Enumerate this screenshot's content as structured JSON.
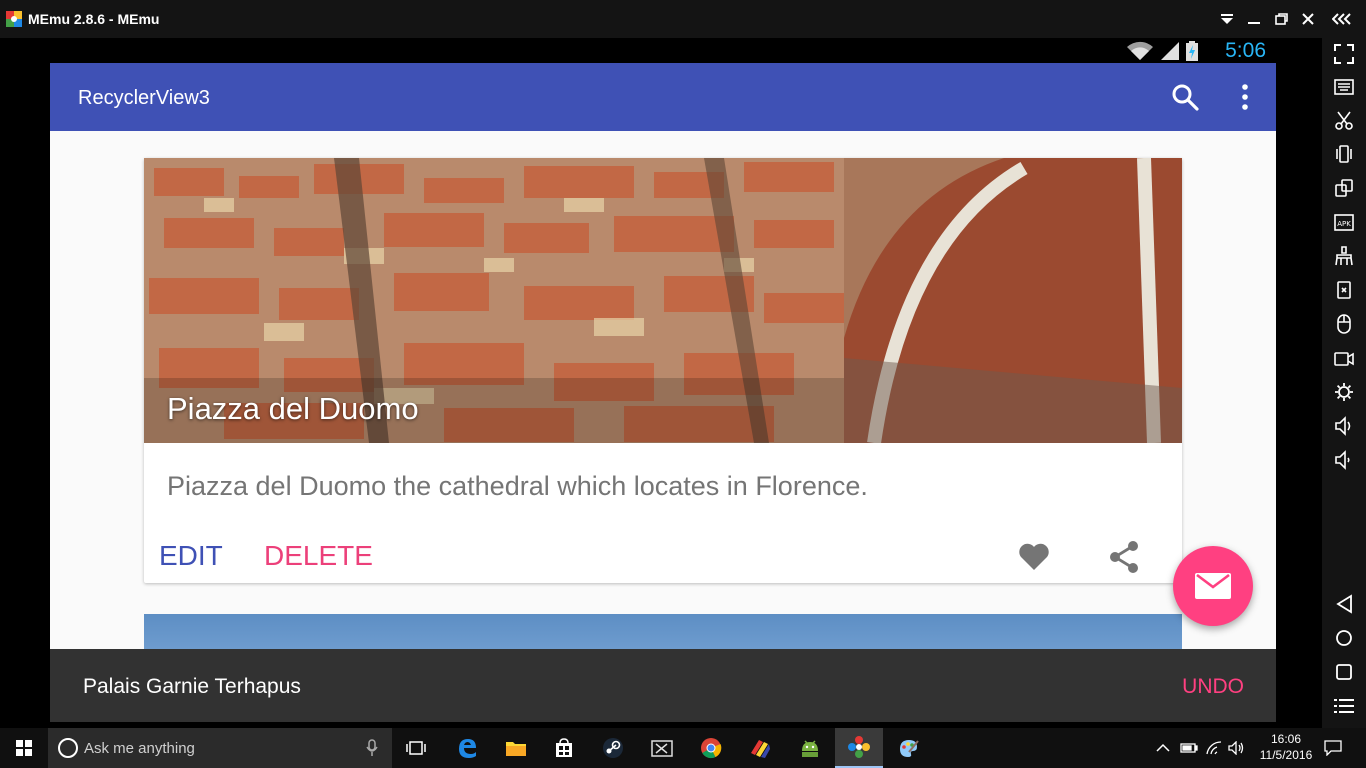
{
  "window": {
    "title": "MEmu 2.8.6 - MEmu",
    "icons": [
      "memu-logo-icon",
      "dropdown-icon",
      "minimize-icon",
      "restore-icon",
      "close-icon",
      "collapse-icon"
    ]
  },
  "android": {
    "status": {
      "time": "5:06"
    },
    "appbar": {
      "title": "RecyclerView3",
      "actions": [
        "search-icon",
        "more-vert-icon"
      ]
    },
    "cards": [
      {
        "image_title": "Piazza del Duomo",
        "description": "Piazza del Duomo the cathedral which locates in Florence.",
        "actions": {
          "edit": "EDIT",
          "delete": "DELETE"
        },
        "icons": [
          "favorite-icon",
          "share-icon"
        ]
      }
    ],
    "fab": {
      "icon": "email-icon"
    },
    "snackbar": {
      "text": "Palais Garnie Terhapus",
      "action": "UNDO"
    }
  },
  "taskbar": {
    "search_placeholder": "Ask me anything",
    "clock": {
      "time": "16:06",
      "date": "11/5/2016"
    }
  },
  "colors": {
    "primary": "#3f51b5",
    "accent": "#ff4081",
    "statusbar_text": "#29b6f6",
    "snackbar": "#323232"
  }
}
